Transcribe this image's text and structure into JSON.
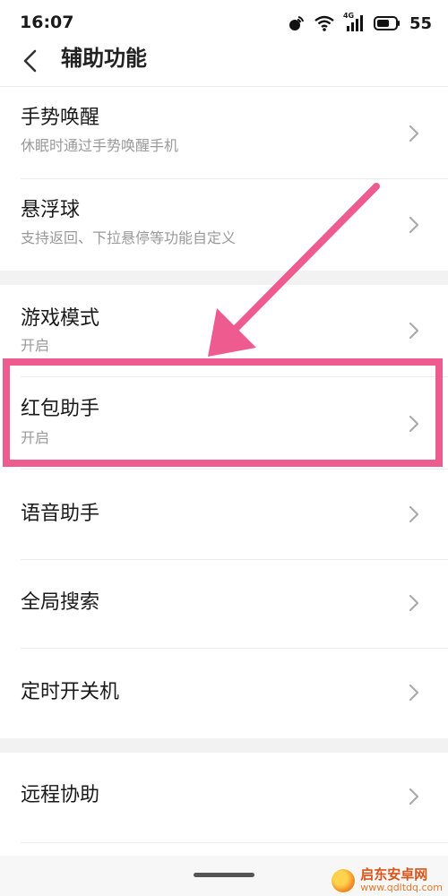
{
  "status_bar": {
    "time": "16:07",
    "network_label": "4G",
    "battery_level": "55"
  },
  "header": {
    "title": "辅助功能"
  },
  "settings": {
    "gesture_wake": {
      "title": "手势唤醒",
      "subtitle": "休眠时通过手势唤醒手机"
    },
    "floating_ball": {
      "title": "悬浮球",
      "subtitle": "支持返回、下拉悬停等功能自定义"
    },
    "game_mode": {
      "title": "游戏模式",
      "subtitle": "开启"
    },
    "red_packet_assistant": {
      "title": "红包助手",
      "subtitle": "开启"
    },
    "voice_assistant": {
      "title": "语音助手"
    },
    "global_search": {
      "title": "全局搜索"
    },
    "scheduled_power": {
      "title": "定时开关机"
    },
    "remote_assist": {
      "title": "远程协助"
    }
  },
  "annotation": {
    "color": "#ee5b8e"
  },
  "watermark": {
    "name": "启东安卓网",
    "url": "www.qdltdq.com"
  },
  "colors": {
    "title_text": "#1a1a1a",
    "subtitle_text": "#9a9a9a",
    "divider": "#ececec",
    "section_gap": "#f2f2f2",
    "chevron": "#aaaaaa"
  }
}
